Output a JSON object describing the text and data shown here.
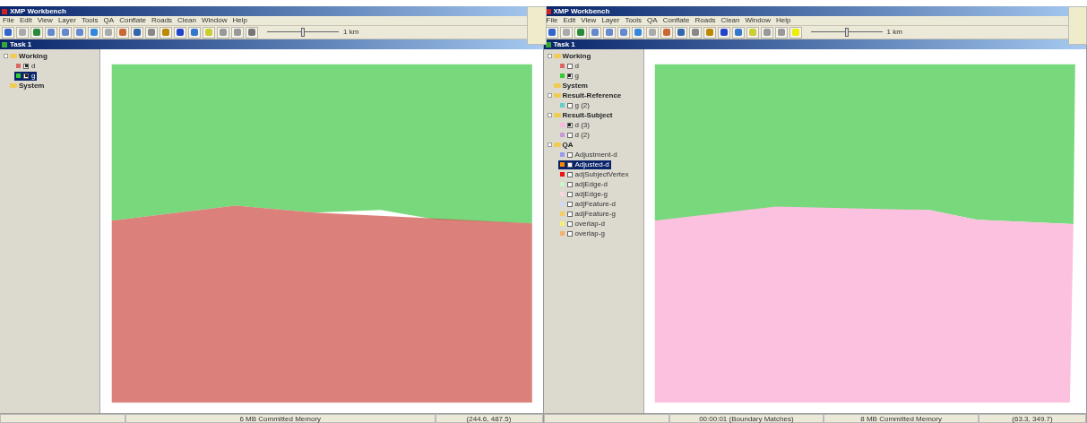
{
  "windows": [
    {
      "title": "XMP Workbench",
      "menu": [
        "File",
        "Edit",
        "View",
        "Layer",
        "Tools",
        "QA",
        "Conflate",
        "Roads",
        "Clean",
        "Window",
        "Help"
      ],
      "scale": {
        "level": 0.5,
        "label": "1 km"
      },
      "task": "Task 1",
      "tree": [
        {
          "name": "Working",
          "children": [
            {
              "name": "d",
              "color": "#e06666",
              "checked": true,
              "selected": false
            },
            {
              "name": "g",
              "color": "#33cc33",
              "checked": true,
              "selected": true
            }
          ]
        },
        {
          "name": "System"
        }
      ],
      "status_bar": [
        "6 MB Committed Memory",
        "(244.6, 487.5)"
      ]
    },
    {
      "title": "XMP Workbench",
      "menu": [
        "File",
        "Edit",
        "View",
        "Layer",
        "Tools",
        "QA",
        "Conflate",
        "Roads",
        "Clean",
        "Window",
        "Help"
      ],
      "scale": {
        "level": 0.5,
        "label": "1 km"
      },
      "task": "Task 1",
      "tree": [
        {
          "name": "Working",
          "children": [
            {
              "name": "d",
              "color": "#e06666",
              "checked": false,
              "selected": false
            },
            {
              "name": "g",
              "color": "#33cc33",
              "checked": true,
              "selected": false
            }
          ]
        },
        {
          "name": "System"
        },
        {
          "name": "Result-Reference",
          "children": [
            {
              "name": "g (2)",
              "color": "#66cccc",
              "checked": false,
              "selected": false
            }
          ]
        },
        {
          "name": "Result-Subject",
          "children": [
            {
              "name": "d (3)",
              "color": "#f9b8dc",
              "checked": true,
              "selected": false
            },
            {
              "name": "d (2)",
              "color": "#c899d6",
              "checked": false,
              "selected": false
            }
          ]
        },
        {
          "name": "QA",
          "children": [
            {
              "name": "Adjustment-d",
              "color": "#9999ee",
              "checked": false,
              "selected": false
            },
            {
              "name": "Adjusted-d",
              "color": "#ff8800",
              "checked": false,
              "selected": true
            },
            {
              "name": "adjSubjectVertex",
              "color": "#ee1111",
              "checked": false,
              "selected": false
            },
            {
              "name": "adjEdge-d",
              "color": "#ccf5cc",
              "checked": false,
              "selected": false
            },
            {
              "name": "adjEdge-g",
              "color": "#f9d6e0",
              "checked": false,
              "selected": false
            },
            {
              "name": "adjFeature-d",
              "color": "#d3d8f5",
              "checked": false,
              "selected": false
            },
            {
              "name": "adjFeature-g",
              "color": "#f5cc66",
              "checked": false,
              "selected": false
            },
            {
              "name": "overlap-d",
              "color": "#f5f07a",
              "checked": false,
              "selected": false
            },
            {
              "name": "overlap-g",
              "color": "#f5b070",
              "checked": false,
              "selected": false
            }
          ]
        }
      ],
      "status_bar": [
        "00:00:01 (Boundary Matches)",
        "8 MB Committed Memory",
        "(63.3, 349.7)"
      ]
    }
  ]
}
